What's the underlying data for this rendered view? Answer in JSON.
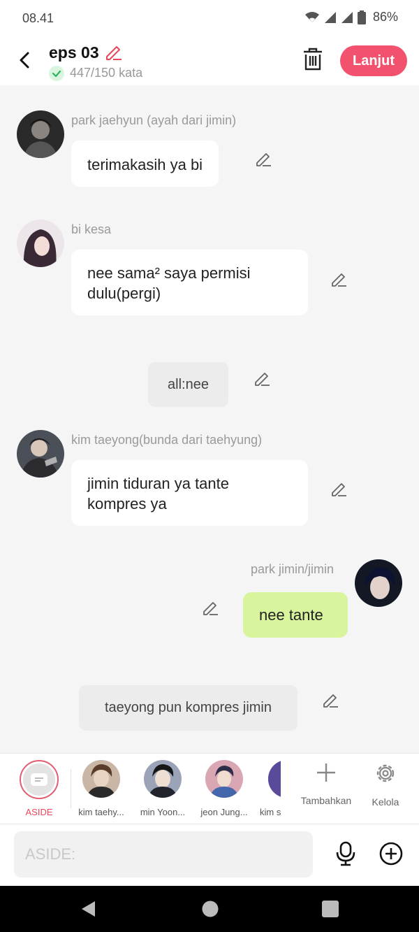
{
  "status_bar": {
    "time": "08.41",
    "battery": "86%"
  },
  "header": {
    "title": "eps 03",
    "word_count": "447/150 kata",
    "next_button": "Lanjut"
  },
  "messages": [
    {
      "type": "character",
      "name": "park jaehyun (ayah dari jimin)",
      "text": "terimakasih ya bi"
    },
    {
      "type": "character",
      "name": "bi kesa",
      "text": "nee sama² saya permisi dulu(pergi)"
    },
    {
      "type": "narration",
      "text": "all:nee"
    },
    {
      "type": "character",
      "name": "kim taeyong(bunda dari taehyung)",
      "text": "jimin tiduran ya tante kompres ya"
    },
    {
      "type": "self",
      "name": "park jimin/jimin",
      "text": "nee tante"
    },
    {
      "type": "narration",
      "text": "taeyong pun kompres jimin"
    }
  ],
  "character_bar": {
    "aside_label": "ASIDE",
    "characters": [
      "kim taehy...",
      "min Yoon...",
      "jeon Jung...",
      "kim s"
    ],
    "add_label": "Tambahkan",
    "manage_label": "Kelola"
  },
  "input": {
    "placeholder": "ASIDE:"
  },
  "colors": {
    "accent": "#f2526d",
    "self_bubble": "#d8f59e",
    "aside": "#e8475c"
  }
}
